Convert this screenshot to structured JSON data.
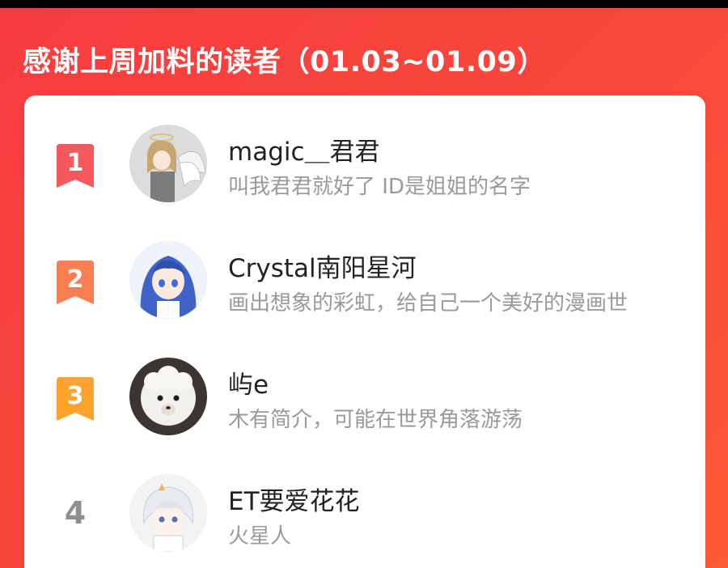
{
  "header": {
    "title": "感谢上周加料的读者（01.03~01.09）"
  },
  "colors": {
    "background_accent": "#f9473c",
    "rank_1": "#f5595e",
    "rank_2": "#f97e54",
    "rank_3": "#fba32d",
    "rank_other": "#8f8f8f"
  },
  "readers": [
    {
      "rank": "1",
      "name": "magic＿君君",
      "bio": "叫我君君就好了 ID是姐姐的名字",
      "avatar_icon": "anime-angel-avatar-icon"
    },
    {
      "rank": "2",
      "name": "Crystal南阳星河",
      "bio": "画出想象的彩虹，给自己一个美好的漫画世",
      "avatar_icon": "anime-blue-hair-girl-avatar-icon"
    },
    {
      "rank": "3",
      "name": "屿e",
      "bio": "木有简介，可能在世界角落游荡",
      "avatar_icon": "alpaca-avatar-icon"
    },
    {
      "rank": "4",
      "name": "ET要爱花花",
      "bio": "火星人",
      "avatar_icon": "anime-white-hair-boy-avatar-icon"
    }
  ]
}
